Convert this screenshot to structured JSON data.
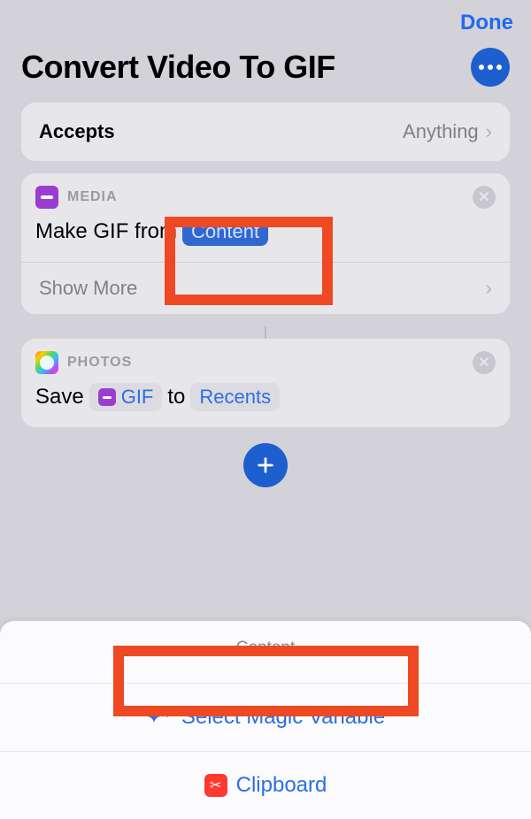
{
  "topbar": {
    "done": "Done"
  },
  "title": "Convert Video To GIF",
  "accepts": {
    "label": "Accepts",
    "value": "Anything"
  },
  "action1": {
    "category": "MEDIA",
    "prefix": "Make GIF from",
    "variable": "Content",
    "showMore": "Show More"
  },
  "action2": {
    "category": "PHOTOS",
    "save": "Save",
    "gif": "GIF",
    "to": "to",
    "recents": "Recents"
  },
  "sheet": {
    "title": "Content",
    "magic": "Select Magic Variable",
    "clipboard": "Clipboard"
  }
}
